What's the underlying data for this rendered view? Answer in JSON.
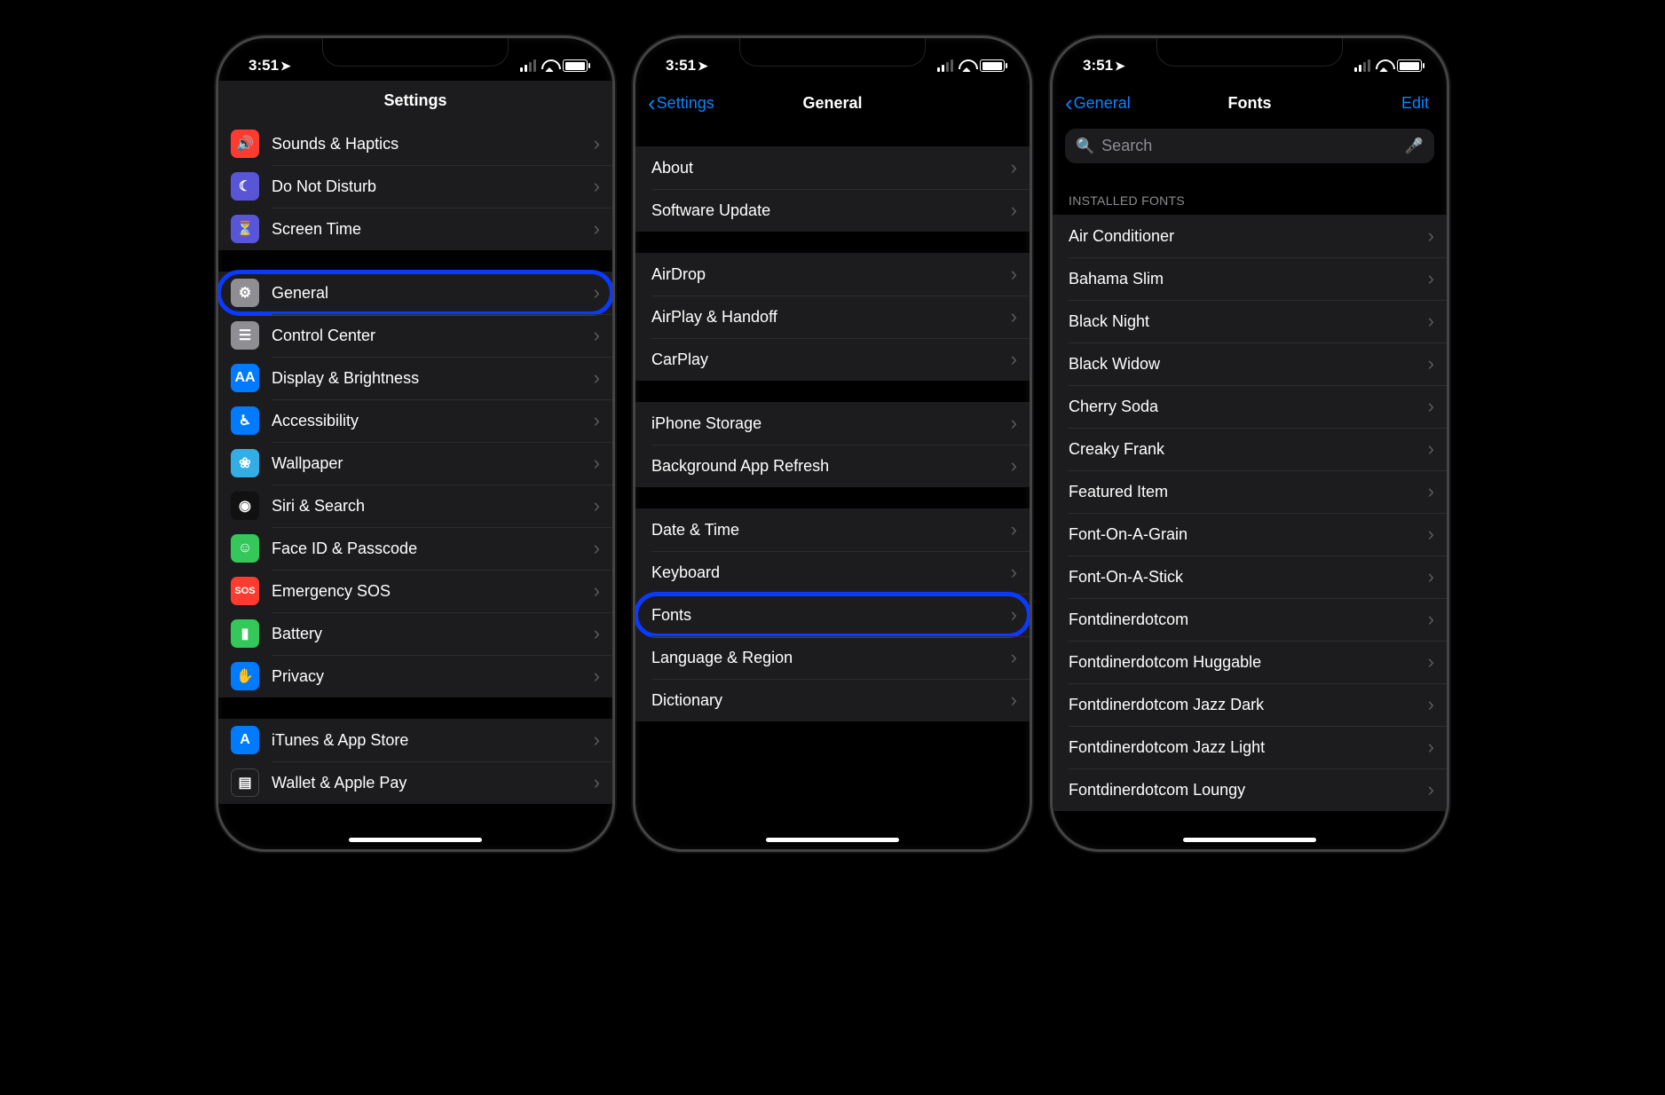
{
  "statusbar": {
    "time": "3:51"
  },
  "screen1": {
    "title": "Settings",
    "group1": [
      {
        "icon": "volume-icon",
        "color": "ic-red",
        "glyph": "🔊",
        "label": "Sounds & Haptics"
      },
      {
        "icon": "moon-icon",
        "color": "ic-purple",
        "glyph": "☾",
        "label": "Do Not Disturb"
      },
      {
        "icon": "hourglass-icon",
        "color": "ic-purple2",
        "glyph": "⏳",
        "label": "Screen Time"
      }
    ],
    "group2": [
      {
        "icon": "gear-icon",
        "color": "ic-gray",
        "glyph": "⚙",
        "label": "General",
        "highlight": true
      },
      {
        "icon": "toggles-icon",
        "color": "ic-gray",
        "glyph": "☰",
        "label": "Control Center"
      },
      {
        "icon": "aa-icon",
        "color": "ic-blue",
        "glyph": "AA",
        "label": "Display & Brightness"
      },
      {
        "icon": "accessibility-icon",
        "color": "ic-bluea",
        "glyph": "♿︎",
        "label": "Accessibility"
      },
      {
        "icon": "flower-icon",
        "color": "ic-cyan",
        "glyph": "❀",
        "label": "Wallpaper"
      },
      {
        "icon": "siri-icon",
        "color": "ic-black",
        "glyph": "◉",
        "label": "Siri & Search"
      },
      {
        "icon": "faceid-icon",
        "color": "ic-green",
        "glyph": "☺",
        "label": "Face ID & Passcode"
      },
      {
        "icon": "sos-icon",
        "color": "ic-sos",
        "glyph": "SOS",
        "label": "Emergency SOS"
      },
      {
        "icon": "battery-icon",
        "color": "ic-green",
        "glyph": "▮",
        "label": "Battery"
      },
      {
        "icon": "hand-icon",
        "color": "ic-hand",
        "glyph": "✋",
        "label": "Privacy"
      }
    ],
    "group3": [
      {
        "icon": "appstore-icon",
        "color": "ic-store",
        "glyph": "A",
        "label": "iTunes & App Store"
      },
      {
        "icon": "wallet-icon",
        "color": "ic-wallet",
        "glyph": "▤",
        "label": "Wallet & Apple Pay"
      }
    ]
  },
  "screen2": {
    "back": "Settings",
    "title": "General",
    "group1": [
      {
        "label": "About"
      },
      {
        "label": "Software Update"
      }
    ],
    "group2": [
      {
        "label": "AirDrop"
      },
      {
        "label": "AirPlay & Handoff"
      },
      {
        "label": "CarPlay"
      }
    ],
    "group3": [
      {
        "label": "iPhone Storage"
      },
      {
        "label": "Background App Refresh"
      }
    ],
    "group4": [
      {
        "label": "Date & Time"
      },
      {
        "label": "Keyboard"
      },
      {
        "label": "Fonts",
        "highlight": true
      },
      {
        "label": "Language & Region"
      },
      {
        "label": "Dictionary"
      }
    ]
  },
  "screen3": {
    "back": "General",
    "title": "Fonts",
    "edit": "Edit",
    "search_placeholder": "Search",
    "section_header": "INSTALLED FONTS",
    "fonts": [
      "Air Conditioner",
      "Bahama Slim",
      "Black Night",
      "Black Widow",
      "Cherry Soda",
      "Creaky Frank",
      "Featured Item",
      "Font-On-A-Grain",
      "Font-On-A-Stick",
      "Fontdinerdotcom",
      "Fontdinerdotcom Huggable",
      "Fontdinerdotcom Jazz Dark",
      "Fontdinerdotcom Jazz Light",
      "Fontdinerdotcom Loungy"
    ]
  }
}
